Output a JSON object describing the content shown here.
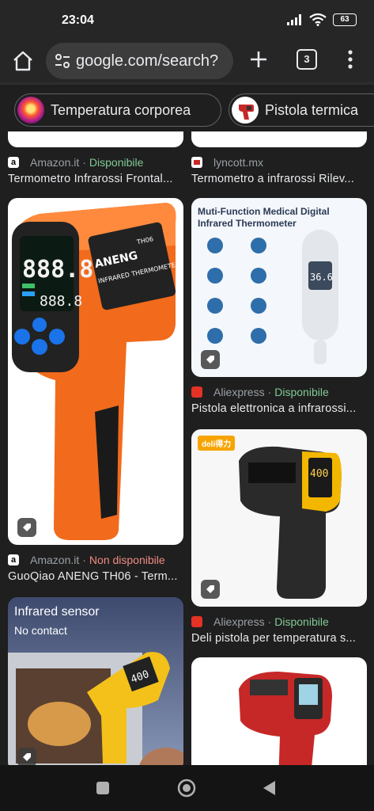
{
  "status_bar": {
    "time": "23:04",
    "battery": "63"
  },
  "browser": {
    "url": "google.com/search?",
    "tab_count": "3"
  },
  "chips": [
    {
      "label": "Temperatura corporea"
    },
    {
      "label": "Pistola termica"
    }
  ],
  "results": [
    {
      "source": "Amazon.it",
      "separator": "·",
      "availability": "Disponibile",
      "title": "Termometro Infrarossi Frontal..."
    },
    {
      "source": "lyncott.mx",
      "title": "Termometro a infrarossi Rilev..."
    },
    {
      "source": "Amazon.it",
      "separator": "·",
      "availability": "Non disponibile",
      "title": "GuoQiao ANENG TH06 - Term..."
    },
    {
      "source": "Aliexpress",
      "separator": "·",
      "availability": "Disponibile",
      "title": "Pistola elettronica a infrarossi..."
    },
    {
      "source": "Aliexpress",
      "separator": "·",
      "availability": "Disponibile",
      "title": "Deli pistola per temperatura s..."
    }
  ],
  "image_text": {
    "medical_title_1": "Muti-Function Medical Digital",
    "medical_title_2": "Infrared Thermometer",
    "infrared_1": "Infrared sensor",
    "infrared_2": "No contact",
    "aneng_brand": "ANENG",
    "aneng_model": "TH06",
    "aneng_display": "888.8",
    "aneng_label": "INFRARED THERMOMETER",
    "deli_brand": "deli得力",
    "deli_display": "400",
    "medical_display": "36.6"
  },
  "colors": {
    "available": "#81c995",
    "unavailable": "#f28b82"
  }
}
